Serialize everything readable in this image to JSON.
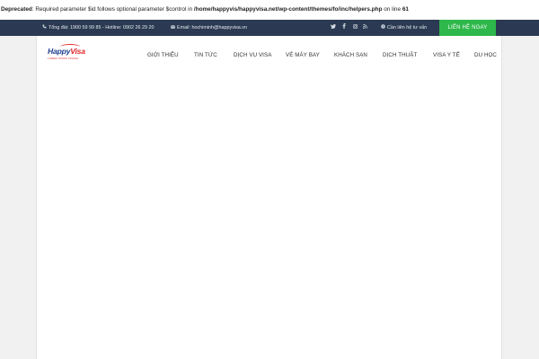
{
  "notice": {
    "label": "Deprecated",
    "message_part1": ": Required parameter $id follows optional parameter $control in ",
    "path": "/home/happyvis/happyvisa.net/wp-content/themes/fo/inc/helpers.php",
    "message_part2": " on line ",
    "line": "61"
  },
  "topbar": {
    "phone": "Tổng đài: 1900 59 99 85 - Hotline: 0902 26 29 20",
    "email": "Email: hochiminh@happyvisa.vn",
    "consult": "Cần liên hệ tư vấn",
    "cta_label": "LIÊN HỆ NGAY",
    "social_icons": [
      "twitter-icon",
      "facebook-icon",
      "instagram-icon",
      "rss-icon"
    ]
  },
  "logo": {
    "text_main": "Happy",
    "text_accent": "Visa",
    "tagline": "LOREM IPSUM TRAVEL"
  },
  "nav": {
    "items": [
      "GIỚI THIỆU",
      "TIN TỨC",
      "DỊCH VỤ VISA",
      "VÉ MÁY BAY",
      "KHÁCH SẠN",
      "DỊCH THUẬT",
      "VISA Y TẾ",
      "DU HỌC"
    ]
  },
  "colors": {
    "topbar_bg": "#2b3a52",
    "cta_bg": "#2eb84b",
    "logo_blue": "#1d3f8f",
    "logo_red": "#e4262b"
  }
}
